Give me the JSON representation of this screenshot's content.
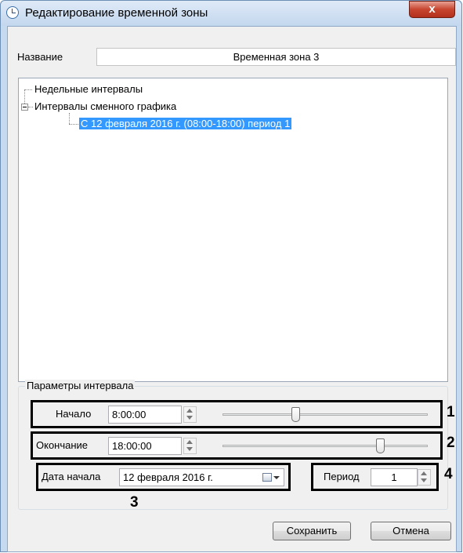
{
  "window": {
    "title": "Редактирование временной зоны",
    "close_glyph": "x",
    "title_icon": "clock-icon"
  },
  "name_field": {
    "label": "Название",
    "value": "Временная зона 3"
  },
  "tree": {
    "items": [
      {
        "label": "Недельные интервалы"
      },
      {
        "label": "Интервалы сменного графика",
        "expanded": true
      },
      {
        "label": "С 12 февраля 2016 г. (08:00-18:00) период 1",
        "selected": true
      }
    ]
  },
  "params": {
    "group_title": "Параметры интервала",
    "start": {
      "label": "Начало",
      "value": "8:00:00",
      "slider_fraction": 0.35
    },
    "end": {
      "label": "Окончание",
      "value": "18:00:00",
      "slider_fraction": 0.78
    },
    "start_date": {
      "label": "Дата начала",
      "value": "12 февраля  2016 г."
    },
    "period": {
      "label": "Период",
      "value": "1"
    }
  },
  "callouts": [
    "1",
    "2",
    "3",
    "4"
  ],
  "buttons": {
    "save": "Сохранить",
    "cancel": "Отмена"
  },
  "colors": {
    "selection": "#3399ff",
    "close_button": "#c7452f",
    "title_bar": "#c5d9ef"
  }
}
